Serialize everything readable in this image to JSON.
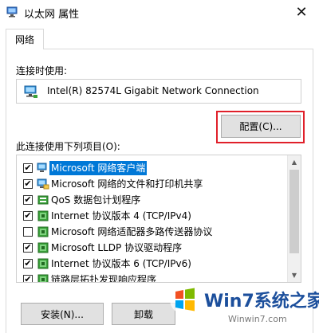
{
  "window": {
    "title": "以太网 属性",
    "close_glyph": "✕"
  },
  "tabs": [
    {
      "label": "网络"
    }
  ],
  "connection": {
    "label": "连接时使用:",
    "adapter_name": "Intel(R) 82574L Gigabit Network Connection",
    "configure_label": "配置(C)..."
  },
  "items": {
    "label": "此连接使用下列项目(O):",
    "list": [
      {
        "checked": true,
        "icon": "network-client-icon",
        "label": "Microsoft 网络客户端",
        "selected": true
      },
      {
        "checked": true,
        "icon": "file-share-icon",
        "label": "Microsoft 网络的文件和打印机共享",
        "selected": false
      },
      {
        "checked": true,
        "icon": "qos-icon",
        "label": "QoS 数据包计划程序",
        "selected": false
      },
      {
        "checked": true,
        "icon": "protocol-icon",
        "label": "Internet 协议版本 4 (TCP/IPv4)",
        "selected": false
      },
      {
        "checked": false,
        "icon": "protocol-icon",
        "label": "Microsoft 网络适配器多路传送器协议",
        "selected": false
      },
      {
        "checked": true,
        "icon": "protocol-icon",
        "label": "Microsoft LLDP 协议驱动程序",
        "selected": false
      },
      {
        "checked": true,
        "icon": "protocol-icon",
        "label": "Internet 协议版本 6 (TCP/IPv6)",
        "selected": false
      },
      {
        "checked": true,
        "icon": "protocol-icon",
        "label": "链路层拓扑发现响应程序",
        "selected": false
      }
    ]
  },
  "buttons": {
    "install_label": "安装(N)...",
    "uninstall_label": "卸载"
  },
  "watermark": {
    "brand": "Win7系统之家",
    "url": "Winwin7.com"
  },
  "colors": {
    "highlight_border": "#e0202a",
    "selection": "#0078d7"
  }
}
